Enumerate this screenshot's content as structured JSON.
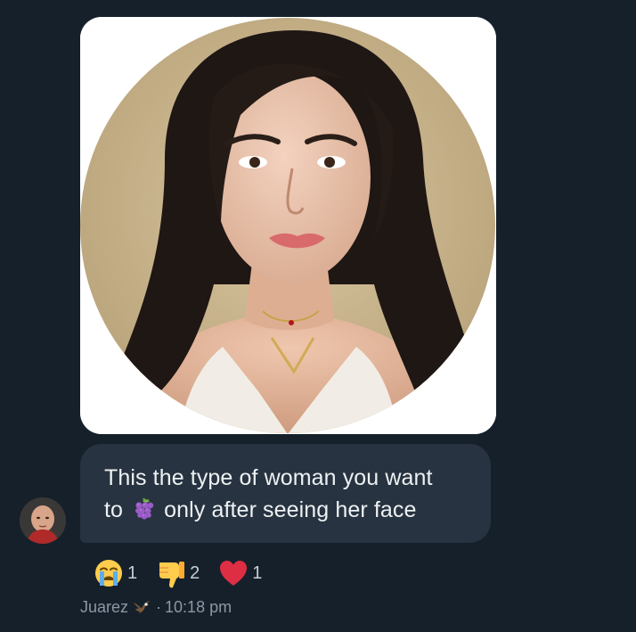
{
  "message": {
    "line1": "This the type of woman you want",
    "line2_before": "to",
    "line2_after": "only after seeing her face",
    "emoji_icon": "grapes-icon"
  },
  "reactions": [
    {
      "icon": "crying-face-icon",
      "count": "1"
    },
    {
      "icon": "thumbs-down-icon",
      "count": "2"
    },
    {
      "icon": "red-heart-icon",
      "count": "1"
    }
  ],
  "meta": {
    "sender": "Juarez",
    "sender_badge_icon": "eagle-icon",
    "separator": "·",
    "time": "10:18 pm"
  },
  "colors": {
    "background": "#15202b",
    "bubble": "#273340",
    "meta_text": "#8b98a5"
  }
}
